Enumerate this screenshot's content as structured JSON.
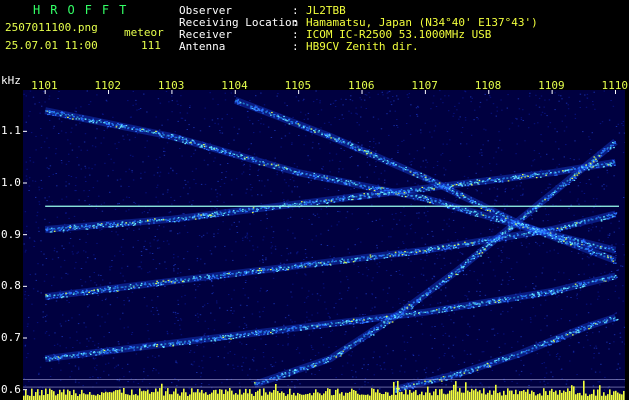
{
  "header": {
    "app_name": "HROFFT",
    "filename": "2507011100.png",
    "datetime": "25.07.01 11:00",
    "mode_label": "meteor",
    "count": "111",
    "fields": [
      {
        "label": "Observer",
        "value": "JL2TBB"
      },
      {
        "label": "Receiving Location",
        "value": "Hamamatsu, Japan (N34°40' E137°43')"
      },
      {
        "label": "Receiver",
        "value": "ICOM IC-R2500 53.1000MHz USB"
      },
      {
        "label": "Antenna",
        "value": "HB9CV Zenith dir."
      }
    ],
    "colon": ":"
  },
  "colors": {
    "background": "#000000",
    "plot_bg": "#000040",
    "header_text": "#e6ff4c",
    "trace": "#33ccff",
    "signal_line": "#99ffee",
    "bottom_bars": "#f2ff3c"
  },
  "chart_data": {
    "type": "heatmap",
    "x_unit_label": "",
    "y_unit_label": "kHz",
    "x_ticks": [
      "1101",
      "1102",
      "1103",
      "1104",
      "1105",
      "1106",
      "1107",
      "1108",
      "1109",
      "1110"
    ],
    "y_ticks": [
      "1.1",
      "1.0",
      "0.9",
      "0.8",
      "0.7",
      "0.6"
    ],
    "ylim": [
      0.58,
      1.18
    ],
    "signal_line_khz": 0.955,
    "reference_lines_khz": [
      0.62,
      0.605
    ],
    "traces": [
      {
        "x": [
          1101.0,
          1103.0,
          1105.0,
          1107.0,
          1109.0,
          1110.0
        ],
        "y": [
          1.14,
          1.09,
          1.02,
          0.97,
          0.9,
          0.87
        ]
      },
      {
        "x": [
          1101.0,
          1103.0,
          1105.0,
          1107.0,
          1109.0,
          1110.0
        ],
        "y": [
          0.91,
          0.93,
          0.96,
          0.99,
          1.02,
          1.04
        ]
      },
      {
        "x": [
          1101.0,
          1103.0,
          1105.0,
          1107.0,
          1109.0,
          1110.0
        ],
        "y": [
          0.78,
          0.81,
          0.84,
          0.87,
          0.91,
          0.94
        ]
      },
      {
        "x": [
          1101.0,
          1103.0,
          1105.0,
          1107.0,
          1109.0,
          1110.0
        ],
        "y": [
          0.66,
          0.69,
          0.72,
          0.75,
          0.79,
          0.82
        ]
      },
      {
        "x": [
          1104.3,
          1105.5,
          1106.5,
          1107.5,
          1108.5,
          1109.5,
          1110.0
        ],
        "y": [
          0.61,
          0.66,
          0.74,
          0.83,
          0.93,
          1.03,
          1.08
        ]
      },
      {
        "x": [
          1104.0,
          1105.5,
          1107.0,
          1108.5,
          1110.0
        ],
        "y": [
          1.16,
          1.09,
          1.01,
          0.92,
          0.85
        ]
      },
      {
        "x": [
          1106.5,
          1107.5,
          1108.5,
          1109.5,
          1110.0
        ],
        "y": [
          0.6,
          0.63,
          0.67,
          0.72,
          0.74
        ]
      }
    ]
  }
}
